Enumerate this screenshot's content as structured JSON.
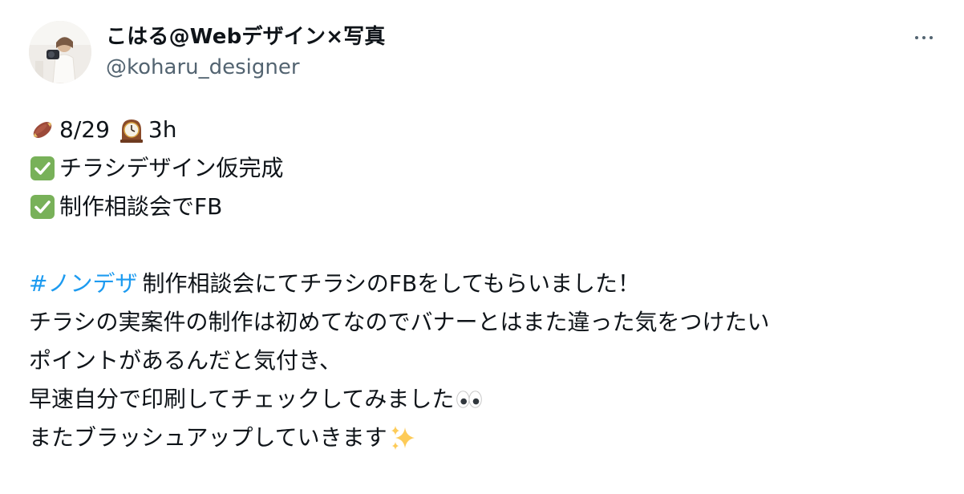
{
  "author": {
    "display_name": "こはる@Webデザイン×写真",
    "handle": "@koharu_designer"
  },
  "post": {
    "line1": {
      "emoji1": "sweet-potato-icon",
      "date": "8/29",
      "emoji2": "clock-icon",
      "hours": "3h"
    },
    "line2": {
      "emoji": "check-mark-icon",
      "text": "チラシデザイン仮完成"
    },
    "line3": {
      "emoji": "check-mark-icon",
      "text": "制作相談会でFB"
    },
    "line5": {
      "hashtag": "#ノンデザ",
      "text": "制作相談会にてチラシのFBをしてもらいました！"
    },
    "line6": {
      "text": "チラシの実案件の制作は初めてなのでバナーとはまた違った気をつけたい"
    },
    "line7": {
      "text": "ポイントがあるんだと気付き、"
    },
    "line8": {
      "text": "早速自分で印刷してチェックしてみました",
      "emoji": "eyes-icon"
    },
    "line9": {
      "text": "またブラッシュアップしていきます",
      "emoji": "sparkles-icon"
    }
  },
  "colors": {
    "text": "#0f1419",
    "secondary": "#536471",
    "link": "#1d9bf0",
    "check_green": "#78b159"
  }
}
